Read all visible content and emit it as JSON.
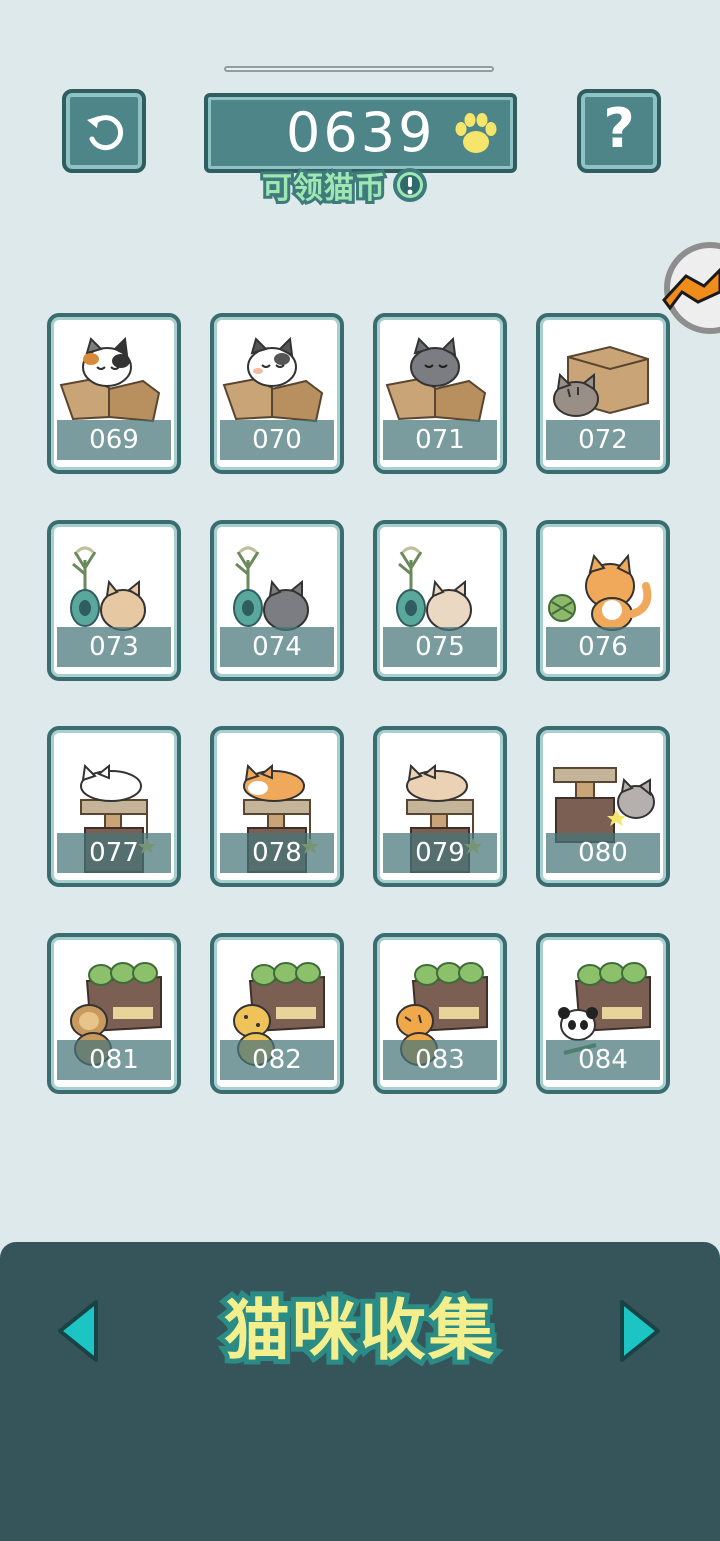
{
  "header": {
    "coins": "0639",
    "claim_label": "可领猫币",
    "back_icon": "undo-arrow-icon",
    "help_icon": "question-mark-icon",
    "coin_icon": "paw-icon",
    "info_icon": "exclamation-icon"
  },
  "collection": {
    "cards": [
      {
        "number": "069",
        "art": "calico-cat-in-box"
      },
      {
        "number": "070",
        "art": "white-cat-in-box"
      },
      {
        "number": "071",
        "art": "gray-cat-in-box"
      },
      {
        "number": "072",
        "art": "tabby-cat-under-box"
      },
      {
        "number": "073",
        "art": "cream-cat-with-plant"
      },
      {
        "number": "074",
        "art": "gray-cat-with-plant"
      },
      {
        "number": "075",
        "art": "beige-cat-with-plant"
      },
      {
        "number": "076",
        "art": "orange-cat-with-toy"
      },
      {
        "number": "077",
        "art": "white-cat-on-tower"
      },
      {
        "number": "078",
        "art": "orange-cat-on-tower"
      },
      {
        "number": "079",
        "art": "cream-cat-on-tower"
      },
      {
        "number": "080",
        "art": "gray-cat-by-tower"
      },
      {
        "number": "081",
        "art": "lion-with-crate"
      },
      {
        "number": "082",
        "art": "leopard-with-crate"
      },
      {
        "number": "083",
        "art": "tiger-with-crate"
      },
      {
        "number": "084",
        "art": "panda-with-crate"
      }
    ]
  },
  "footer": {
    "title": "猫咪收集",
    "prev_icon": "triangle-left-icon",
    "next_icon": "triangle-right-icon"
  },
  "colors": {
    "background": "#dde9ea",
    "panel": "#4e8589",
    "panel_border": "#2f5d60",
    "footer": "#36555a",
    "accent_cyan": "#1cc4c4",
    "title_yellow": "#f4ef8d",
    "paw_yellow": "#f5e56a"
  }
}
